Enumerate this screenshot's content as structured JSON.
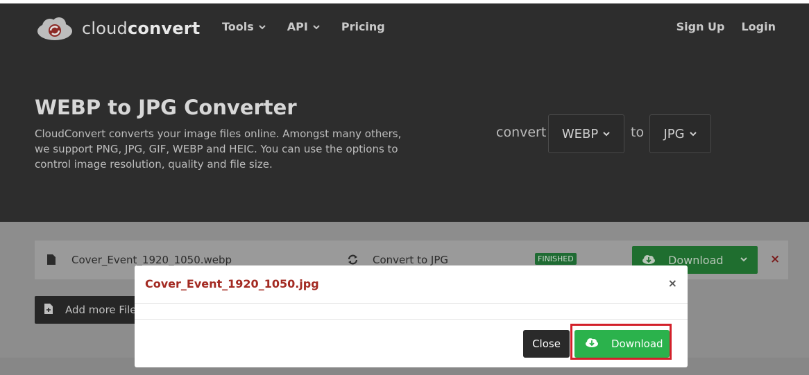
{
  "header": {
    "logo_light": "cloud",
    "logo_bold": "convert",
    "nav": [
      {
        "label": "Tools",
        "has_dropdown": true
      },
      {
        "label": "API",
        "has_dropdown": true
      },
      {
        "label": "Pricing",
        "has_dropdown": false
      }
    ],
    "auth": {
      "signup": "Sign Up",
      "login": "Login"
    }
  },
  "hero": {
    "title": "WEBP to JPG Converter",
    "description": "CloudConvert converts your image files online. Amongst many others, we support PNG, JPG, GIF, WEBP and HEIC. You can use the options to control image resolution, quality and file size.",
    "convert_label": "convert",
    "from_format": "WEBP",
    "to_label": "to",
    "to_format": "JPG"
  },
  "job": {
    "file_name": "Cover_Event_1920_1050.webp",
    "action": "Convert to JPG",
    "status": "FINISHED",
    "download_label": "Download",
    "remove_symbol": "×"
  },
  "add_more_label": "Add more Files",
  "modal": {
    "title": "Cover_Event_1920_1050.jpg",
    "close_symbol": "×",
    "close_label": "Close",
    "download_label": "Download"
  },
  "colors": {
    "header_bg": "#2d2d2d",
    "overlay_bg": "#8d8d8d",
    "download_green": "#2bb24c",
    "highlight_red": "#d3202a",
    "modal_title": "#a32a22"
  }
}
